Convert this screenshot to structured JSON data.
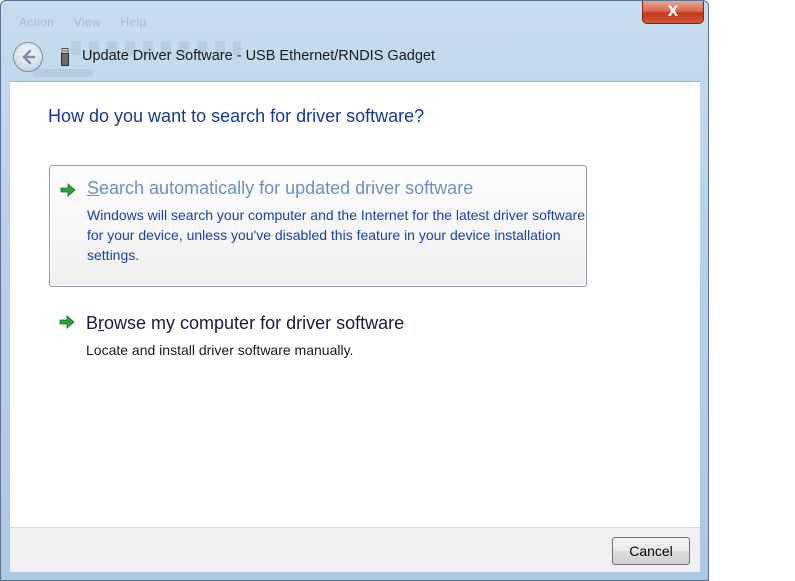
{
  "window": {
    "title": "Update Driver Software - USB Ethernet/RNDIS Gadget",
    "close_label": "X"
  },
  "background_menu": {
    "items": [
      "Action",
      "View",
      "Help"
    ]
  },
  "content": {
    "heading": "How do you want to search for driver software?",
    "options": [
      {
        "title_first": "S",
        "title_rest": "earch automatically for updated driver software",
        "description": "Windows will search your computer and the Internet for the latest driver software for your device, unless you've disabled this feature in your device installation settings."
      },
      {
        "title_first": "B",
        "title_after_r": "r",
        "title_rest": "owse my computer for driver software",
        "description": "Locate and install driver software manually."
      }
    ]
  },
  "footer": {
    "cancel_label": "Cancel"
  },
  "colors": {
    "heading": "#16389a",
    "link_hover": "#6d8fc9",
    "description_blue": "#1a3fb0",
    "green_arrow": "#2aa33a"
  },
  "icons": {
    "back": "back-arrow-icon",
    "device": "usb-device-icon",
    "option_arrow": "green-arrow-icon"
  }
}
